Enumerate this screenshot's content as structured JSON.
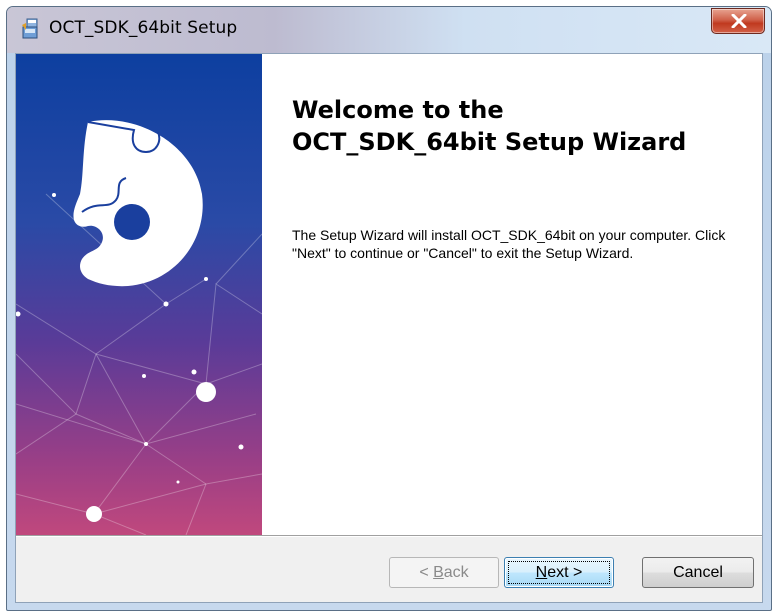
{
  "window": {
    "title": "OCT_SDK_64bit Setup",
    "title_icon": "installer-icon",
    "close_icon": "close-icon"
  },
  "banner": {
    "image": "wizard-banner-puzzle-network",
    "colors": {
      "top": "#0d3fa0",
      "middle": "#4f3a96",
      "bottom": "#c0487d"
    }
  },
  "content": {
    "title_line1": "Welcome to the",
    "title_line2": "OCT_SDK_64bit Setup Wizard",
    "description": "The Setup Wizard will install OCT_SDK_64bit on your computer.  Click \"Next\" to continue or \"Cancel\" to exit the Setup Wizard."
  },
  "buttons": {
    "back": {
      "prefix": "< ",
      "mnemonic": "B",
      "rest": "ack",
      "enabled": false
    },
    "next": {
      "mnemonic": "N",
      "rest": "ext >",
      "enabled": true,
      "focused": true
    },
    "cancel": {
      "label": "Cancel",
      "enabled": true
    }
  }
}
